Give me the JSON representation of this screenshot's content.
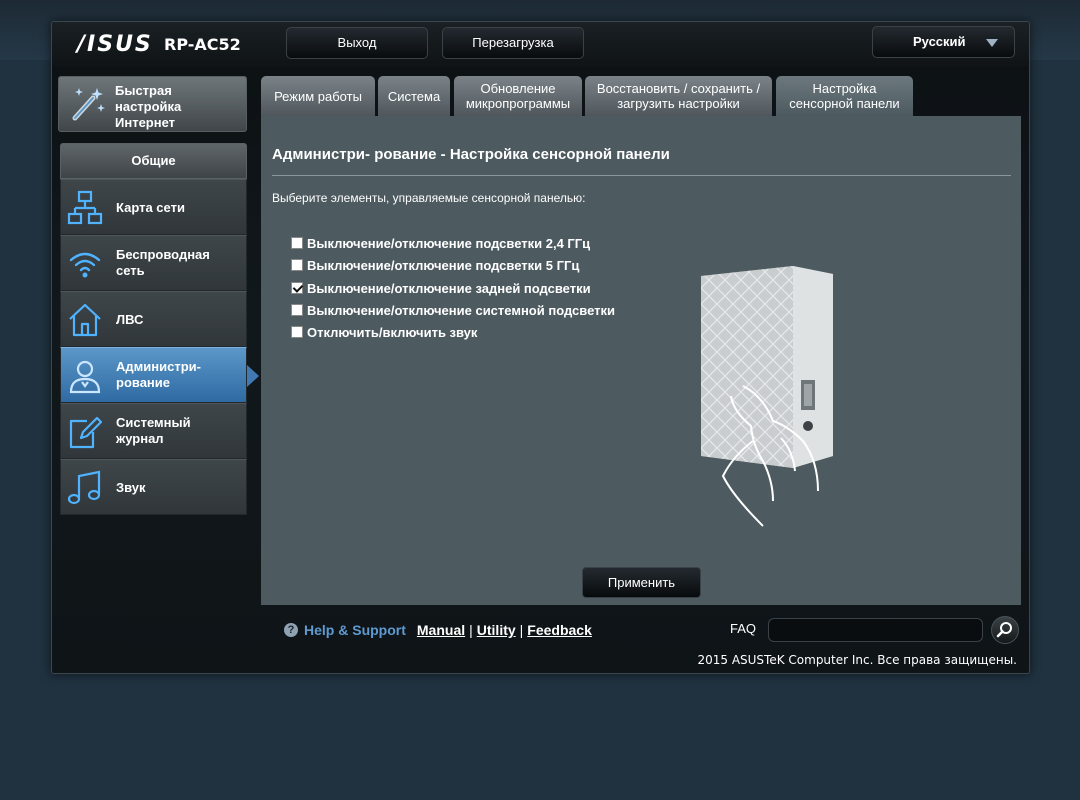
{
  "header": {
    "logo": "/ISUS",
    "model": "RP-AC52",
    "logout_label": "Выход",
    "reboot_label": "Перезагрузка",
    "language": "Русский"
  },
  "sidebar": {
    "quick_setup": "Быстрая настройка Интернет",
    "section_title": "Общие",
    "items": [
      {
        "label": "Карта сети",
        "icon": "network-map-icon"
      },
      {
        "label": "Беспроводная сеть",
        "icon": "wifi-icon"
      },
      {
        "label": "ЛВС",
        "icon": "home-icon"
      },
      {
        "label": "Администри- рование",
        "icon": "admin-user-icon"
      },
      {
        "label": "Системный журнал",
        "icon": "log-edit-icon"
      },
      {
        "label": "Звук",
        "icon": "music-note-icon"
      }
    ],
    "active_index": 3,
    "accent_color": "#3f7ab3"
  },
  "tabs": [
    {
      "label": "Режим работы"
    },
    {
      "label": "Система"
    },
    {
      "label": "Обновление микропрограммы"
    },
    {
      "label": "Восстановить / сохранить / загрузить настройки"
    },
    {
      "label": "Настройка сенсорной панели"
    }
  ],
  "content": {
    "title": "Администри- рование - Настройка сенсорной панели",
    "description": "Выберите элементы, управляемые сенсорной панелью:",
    "options": [
      {
        "label": "Выключение/отключение подсветки 2,4 ГГц",
        "checked": false
      },
      {
        "label": "Выключение/отключение подсветки 5 ГГц",
        "checked": false
      },
      {
        "label": "Выключение/отключение задней подсветки",
        "checked": true
      },
      {
        "label": "Выключение/отключение системной подсветки",
        "checked": false
      },
      {
        "label": "Отключить/включить звук",
        "checked": false
      }
    ],
    "apply_label": "Применить"
  },
  "footer": {
    "help_label": "Help & Support",
    "manual": "Manual",
    "utility": "Utility",
    "feedback": "Feedback",
    "separator": "|",
    "faq_label": "FAQ",
    "faq_value": "",
    "copyright": "2015 ASUSTeK Computer Inc. Все права защищены."
  }
}
